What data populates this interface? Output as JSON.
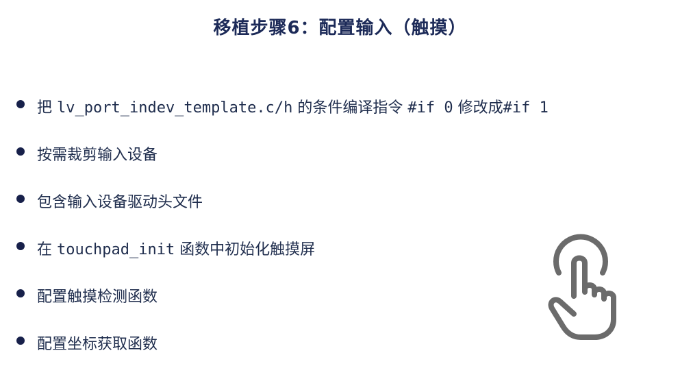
{
  "slide": {
    "title": "移植步骤6：配置输入（触摸）",
    "bullets": [
      {
        "parts": [
          {
            "text": "把 "
          },
          {
            "text": "lv_port_indev_template.c/h",
            "mono": true
          },
          {
            "text": " 的条件编译指令 "
          },
          {
            "text": "#if 0",
            "mono": true
          },
          {
            "text": " 修改成"
          },
          {
            "text": "#if 1",
            "mono": true
          }
        ]
      },
      {
        "parts": [
          {
            "text": "按需裁剪输入设备"
          }
        ]
      },
      {
        "parts": [
          {
            "text": "包含输入设备驱动头文件"
          }
        ]
      },
      {
        "parts": [
          {
            "text": "在 "
          },
          {
            "text": "touchpad_init",
            "mono": true
          },
          {
            "text": " 函数中初始化触摸屏"
          }
        ]
      },
      {
        "parts": [
          {
            "text": "配置触摸检测函数"
          }
        ]
      },
      {
        "parts": [
          {
            "text": "配置坐标获取函数"
          }
        ]
      }
    ],
    "icon": "touch-hand-icon",
    "icon_color": "#6b6b6b",
    "bullet_color": "#17204a",
    "title_color": "#1c2a58"
  }
}
